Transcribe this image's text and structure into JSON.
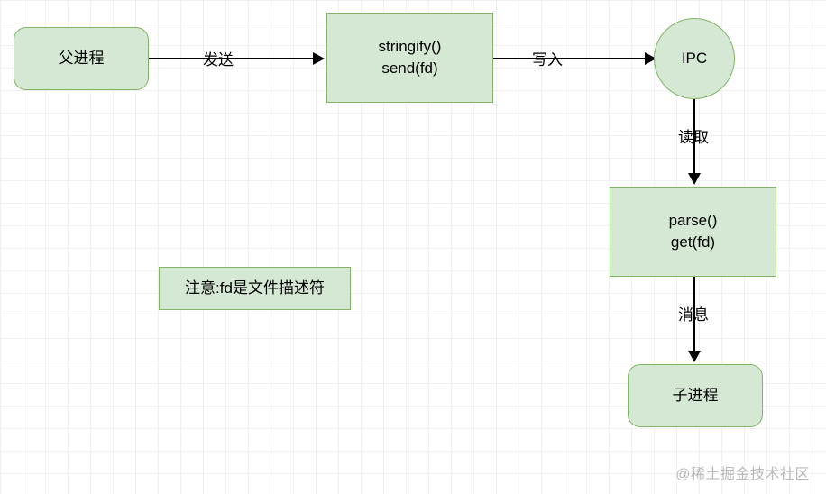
{
  "nodes": {
    "parent": "父进程",
    "stringify_line1": "stringify()",
    "stringify_line2": "send(fd)",
    "ipc": "IPC",
    "parse_line1": "parse()",
    "parse_line2": "get(fd)",
    "child": "子进程",
    "note": "注意:fd是文件描述符"
  },
  "edges": {
    "send": "发送",
    "write": "写入",
    "read": "读取",
    "message": "消息"
  },
  "watermark": "@稀土掘金技术社区"
}
